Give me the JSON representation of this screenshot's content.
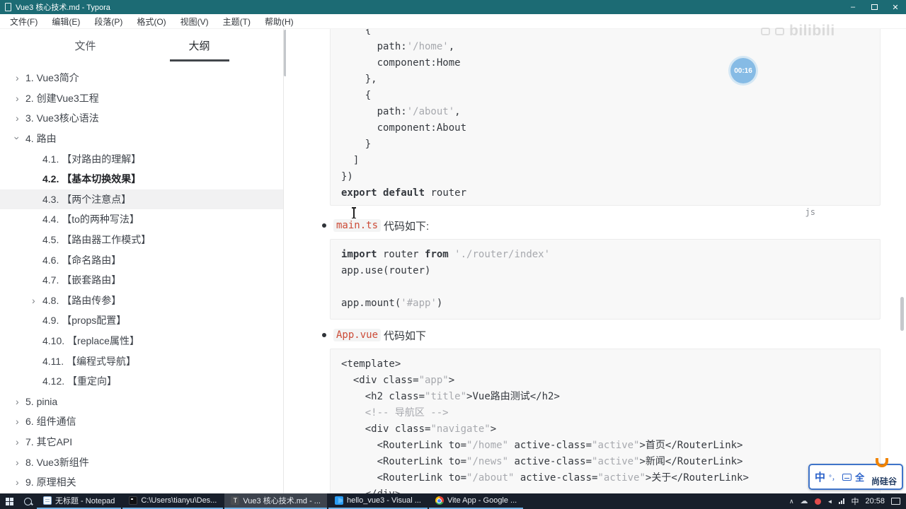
{
  "window": {
    "title": "Vue3 核心技术.md - Typora",
    "controls": {
      "minimize": "–",
      "close": "✕"
    }
  },
  "menu": {
    "items": [
      "文件(F)",
      "编辑(E)",
      "段落(P)",
      "格式(O)",
      "视图(V)",
      "主题(T)",
      "帮助(H)"
    ]
  },
  "icons": {
    "chevron": "›",
    "tray_chevron": "∧",
    "cloud": "☁",
    "volume": "◄"
  },
  "sidebar": {
    "tabs": [
      {
        "label": "文件",
        "active": false
      },
      {
        "label": "大纲",
        "active": true
      }
    ],
    "outline": [
      {
        "label": "1. Vue3简介",
        "indent": 0,
        "chevron": "collapsed",
        "bold": false,
        "selected": false
      },
      {
        "label": "2. 创建Vue3工程",
        "indent": 0,
        "chevron": "collapsed",
        "bold": false,
        "selected": false
      },
      {
        "label": "3. Vue3核心语法",
        "indent": 0,
        "chevron": "collapsed",
        "bold": false,
        "selected": false
      },
      {
        "label": "4. 路由",
        "indent": 0,
        "chevron": "expanded",
        "bold": false,
        "selected": false
      },
      {
        "label": "4.1. 【对路由的理解】",
        "indent": 1,
        "chevron": "none",
        "bold": false,
        "selected": false
      },
      {
        "label": "4.2. 【基本切换效果】",
        "indent": 1,
        "chevron": "none",
        "bold": true,
        "selected": false
      },
      {
        "label": "4.3. 【两个注意点】",
        "indent": 1,
        "chevron": "none",
        "bold": false,
        "selected": true
      },
      {
        "label": "4.4. 【to的两种写法】",
        "indent": 1,
        "chevron": "none",
        "bold": false,
        "selected": false
      },
      {
        "label": "4.5. 【路由器工作模式】",
        "indent": 1,
        "chevron": "none",
        "bold": false,
        "selected": false
      },
      {
        "label": "4.6. 【命名路由】",
        "indent": 1,
        "chevron": "none",
        "bold": false,
        "selected": false
      },
      {
        "label": "4.7. 【嵌套路由】",
        "indent": 1,
        "chevron": "none",
        "bold": false,
        "selected": false
      },
      {
        "label": "4.8. 【路由传参】",
        "indent": 1,
        "chevron": "collapsed",
        "bold": false,
        "selected": false
      },
      {
        "label": "4.9. 【props配置】",
        "indent": 1,
        "chevron": "none",
        "bold": false,
        "selected": false
      },
      {
        "label": "4.10. 【replace属性】",
        "indent": 1,
        "chevron": "none",
        "bold": false,
        "selected": false
      },
      {
        "label": "4.11. 【编程式导航】",
        "indent": 1,
        "chevron": "none",
        "bold": false,
        "selected": false
      },
      {
        "label": "4.12. 【重定向】",
        "indent": 1,
        "chevron": "none",
        "bold": false,
        "selected": false
      },
      {
        "label": "5. pinia",
        "indent": 0,
        "chevron": "collapsed",
        "bold": false,
        "selected": false
      },
      {
        "label": "6. 组件通信",
        "indent": 0,
        "chevron": "collapsed",
        "bold": false,
        "selected": false
      },
      {
        "label": "7. 其它API",
        "indent": 0,
        "chevron": "collapsed",
        "bold": false,
        "selected": false
      },
      {
        "label": "8. Vue3新组件",
        "indent": 0,
        "chevron": "collapsed",
        "bold": false,
        "selected": false
      },
      {
        "label": "9. 原理相关",
        "indent": 0,
        "chevron": "collapsed",
        "bold": false,
        "selected": false
      }
    ]
  },
  "content": {
    "code_blocks": [
      {
        "name": "router-index",
        "lang": "js",
        "lines": [
          [
            {
              "t": "    {",
              "c": "p"
            }
          ],
          [
            {
              "t": "      path:",
              "c": "p"
            },
            {
              "t": "'/home'",
              "c": "s"
            },
            {
              "t": ",",
              "c": "p"
            }
          ],
          [
            {
              "t": "      component:Home",
              "c": "p"
            }
          ],
          [
            {
              "t": "    },",
              "c": "p"
            }
          ],
          [
            {
              "t": "    {",
              "c": "p"
            }
          ],
          [
            {
              "t": "      path:",
              "c": "p"
            },
            {
              "t": "'/about'",
              "c": "s"
            },
            {
              "t": ",",
              "c": "p"
            }
          ],
          [
            {
              "t": "      component:About",
              "c": "p"
            }
          ],
          [
            {
              "t": "    }",
              "c": "p"
            }
          ],
          [
            {
              "t": "  ]",
              "c": "p"
            }
          ],
          [
            {
              "t": "})",
              "c": "p"
            }
          ],
          [
            {
              "t": "export",
              "c": "k"
            },
            {
              "t": " ",
              "c": "p"
            },
            {
              "t": "default",
              "c": "k"
            },
            {
              "t": " router",
              "c": "p"
            }
          ]
        ]
      },
      {
        "name": "main-ts",
        "lines": [
          [
            {
              "t": "import",
              "c": "k"
            },
            {
              "t": " router ",
              "c": "p"
            },
            {
              "t": "from",
              "c": "k"
            },
            {
              "t": " ",
              "c": "p"
            },
            {
              "t": "'./router/index'",
              "c": "s"
            }
          ],
          [
            {
              "t": "app.use(router)",
              "c": "p"
            }
          ],
          [],
          [
            {
              "t": "app.mount(",
              "c": "p"
            },
            {
              "t": "'#app'",
              "c": "s"
            },
            {
              "t": ")",
              "c": "p"
            }
          ]
        ]
      },
      {
        "name": "app-vue",
        "lines": [
          [
            {
              "t": "<template>",
              "c": "p"
            }
          ],
          [
            {
              "t": "  <div class=",
              "c": "p"
            },
            {
              "t": "\"app\"",
              "c": "s"
            },
            {
              "t": ">",
              "c": "p"
            }
          ],
          [
            {
              "t": "    <h2 class=",
              "c": "p"
            },
            {
              "t": "\"title\"",
              "c": "s"
            },
            {
              "t": ">Vue路由测试</h2>",
              "c": "p"
            }
          ],
          [
            {
              "t": "    <!-- 导航区 -->",
              "c": "c"
            }
          ],
          [
            {
              "t": "    <div class=",
              "c": "p"
            },
            {
              "t": "\"navigate\"",
              "c": "s"
            },
            {
              "t": ">",
              "c": "p"
            }
          ],
          [
            {
              "t": "      <RouterLink to=",
              "c": "p"
            },
            {
              "t": "\"/home\"",
              "c": "s"
            },
            {
              "t": " active-class=",
              "c": "p"
            },
            {
              "t": "\"active\"",
              "c": "s"
            },
            {
              "t": ">首页</RouterLink>",
              "c": "p"
            }
          ],
          [
            {
              "t": "      <RouterLink to=",
              "c": "p"
            },
            {
              "t": "\"/news\"",
              "c": "s"
            },
            {
              "t": " active-class=",
              "c": "p"
            },
            {
              "t": "\"active\"",
              "c": "s"
            },
            {
              "t": ">新闻</RouterLink>",
              "c": "p"
            }
          ],
          [
            {
              "t": "      <RouterLink to=",
              "c": "p"
            },
            {
              "t": "\"/about\"",
              "c": "s"
            },
            {
              "t": " active-class=",
              "c": "p"
            },
            {
              "t": "\"active\"",
              "c": "s"
            },
            {
              "t": ">关于</RouterLink>",
              "c": "p"
            }
          ],
          [
            {
              "t": "    </div>",
              "c": "p"
            }
          ]
        ]
      }
    ],
    "bullets": [
      {
        "code": "main.ts",
        "text": "代码如下:"
      },
      {
        "code": "App.vue",
        "text": "代码如下"
      }
    ]
  },
  "overlays": {
    "watermark_text": "bilibili",
    "timer_badge": "00:16",
    "ime_toolbar": {
      "mode": "中",
      "punct": "°，",
      "fullwidth": "全",
      "brand": "尚硅谷"
    }
  },
  "taskbar": {
    "buttons": [
      {
        "label": "无标题 - Notepad",
        "icon": "notepad",
        "active": false
      },
      {
        "label": "C:\\Users\\tianyu\\Des...",
        "icon": "cmd",
        "active": false
      },
      {
        "label": "Vue3 核心技术.md - ...",
        "icon": "typora",
        "active": true
      },
      {
        "label": "hello_vue3 - Visual ...",
        "icon": "vscode",
        "active": false
      },
      {
        "label": "Vite App - Google ...",
        "icon": "chrome",
        "active": false
      }
    ],
    "tray": {
      "ime": "中",
      "time": "20:58"
    }
  }
}
